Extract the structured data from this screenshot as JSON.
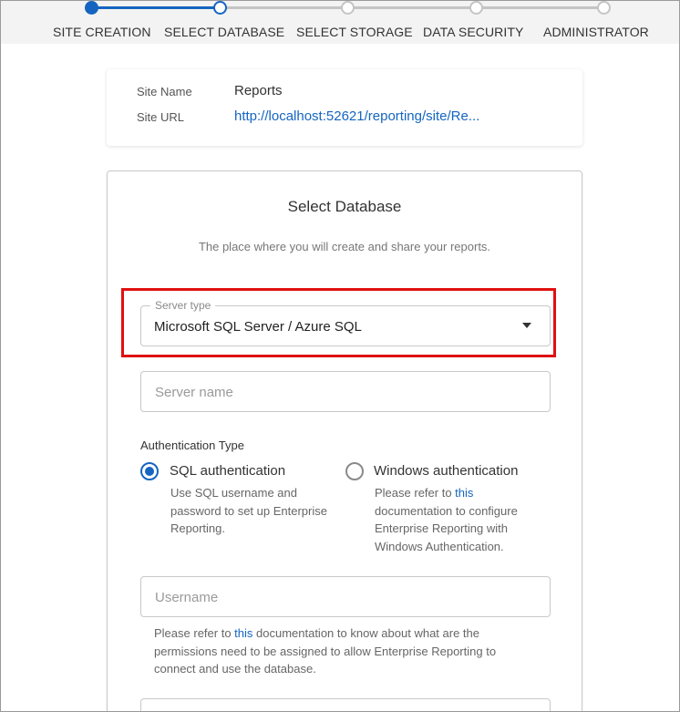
{
  "stepper": {
    "steps": [
      {
        "label": "SITE CREATION",
        "state": "done"
      },
      {
        "label": "SELECT DATABASE",
        "state": "active"
      },
      {
        "label": "SELECT STORAGE",
        "state": "pending"
      },
      {
        "label": "DATA SECURITY",
        "state": "pending"
      },
      {
        "label": "ADMINISTRATOR",
        "state": "pending"
      }
    ]
  },
  "site_info": {
    "name_label": "Site Name",
    "name_value": "Reports",
    "url_label": "Site URL",
    "url_value": "http://localhost:52621/reporting/site/Re..."
  },
  "select_database": {
    "title": "Select Database",
    "subtitle": "The place where you will create and share your reports.",
    "server_type": {
      "label": "Server type",
      "value": "Microsoft SQL Server / Azure SQL"
    },
    "server_name": {
      "placeholder": "Server name"
    },
    "auth": {
      "section_label": "Authentication Type",
      "options": [
        {
          "label": "SQL authentication",
          "selected": true,
          "desc_lines": [
            "Use SQL username and",
            "password to set up Enterprise",
            "Reporting."
          ]
        },
        {
          "label": "Windows authentication",
          "selected": false,
          "desc_prefix": "Please refer to ",
          "desc_link": "this",
          "desc_lines": [
            "documentation to configure",
            "Enterprise Reporting with",
            "Windows Authentication."
          ]
        }
      ]
    },
    "username": {
      "placeholder": "Username"
    },
    "help": {
      "prefix": "Please refer to ",
      "link": "this",
      "suffix": " documentation to know about what are the permissions need to be assigned to allow Enterprise Reporting to connect and use the database."
    }
  },
  "colors": {
    "accent": "#1565c0",
    "highlight": "#e01010"
  }
}
